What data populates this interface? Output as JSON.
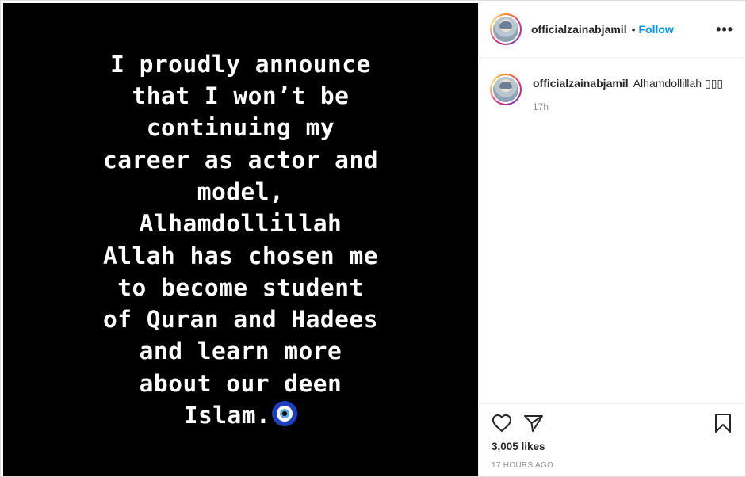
{
  "post": {
    "image_text_lines": [
      "I proudly announce",
      "that I won’t be",
      "continuing my",
      "career as actor and",
      "model,",
      "Alhamdollillah",
      "Allah has chosen me",
      "to become student",
      "of Quran and Hadees",
      "and learn more",
      "about our deen",
      "Islam."
    ],
    "emoji_name": "nazar-amulet-icon"
  },
  "header": {
    "username": "officialzainabjamil",
    "separator": "•",
    "follow_label": "Follow",
    "more_label": "•••"
  },
  "caption": {
    "username": "officialzainabjamil",
    "text": "Alhamdollillah ▯▯▯",
    "time": "17h"
  },
  "actions": {
    "likes": "3,005 likes",
    "time_ago": "17 HOURS AGO"
  },
  "colors": {
    "media_bg": "#000000",
    "follow_blue": "#0095f6",
    "muted": "#8e8e8e"
  }
}
